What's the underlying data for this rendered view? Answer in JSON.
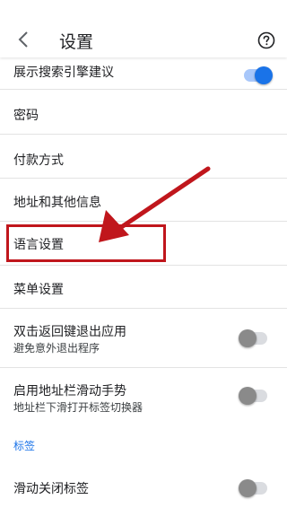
{
  "header": {
    "title": "设置",
    "back_icon": "chevron-left-icon",
    "help_icon": "help-circle-icon"
  },
  "settings": {
    "search_suggestions": {
      "label": "展示搜索引擎建议",
      "enabled": true
    },
    "password": {
      "label": "密码"
    },
    "payment": {
      "label": "付款方式"
    },
    "addresses": {
      "label": "地址和其他信息"
    },
    "language": {
      "label": "语言设置"
    },
    "menu": {
      "label": "菜单设置"
    },
    "double_back_exit": {
      "label": "双击返回键退出应用",
      "sublabel": "避免意外退出程序",
      "enabled": false
    },
    "address_bar_swipe": {
      "label": "启用地址栏滑动手势",
      "sublabel": "地址栏下滑打开标签切换器",
      "enabled": false
    },
    "tabs_section": {
      "header": "标签"
    },
    "swipe_close_tabs": {
      "label": "滑动关闭标签",
      "enabled": false
    }
  },
  "colors": {
    "accent": "#1a73e8",
    "annotation_red": "#c0161c"
  }
}
